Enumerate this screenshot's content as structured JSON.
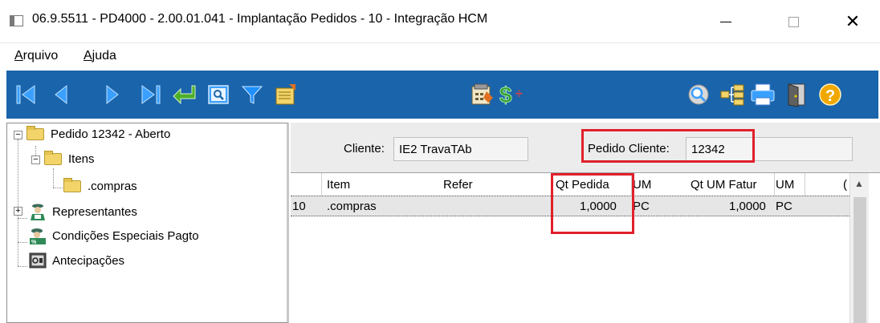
{
  "window": {
    "title": "06.9.5511 - PD4000 - 2.00.01.041 - Implantação Pedidos - 10 - Integração HCM",
    "minimize_glyph": "—",
    "close_glyph": "✕"
  },
  "menu": {
    "items": [
      {
        "label": "Arquivo",
        "mnemonic": "A",
        "rest": "rquivo"
      },
      {
        "label": "Ajuda",
        "mnemonic": "A",
        "rest": "juda"
      }
    ]
  },
  "toolbar": {
    "icons": [
      "first-record-icon",
      "previous-record-icon",
      "next-record-icon",
      "last-record-icon",
      "return-enter-icon",
      "zoom-search-icon",
      "filter-funnel-icon",
      "edit-document-icon",
      "calculator-notepad-icon",
      "money-dollar-icon",
      "query-magnifier-icon",
      "tree-structure-icon",
      "printer-icon",
      "exit-door-icon",
      "help-question-icon"
    ],
    "colors": {
      "background": "#1a64ab",
      "arrows": "#3aa0ff",
      "return": "#4caf2a",
      "filter": "#1e90ff",
      "dollar": "#2e9e2e",
      "help": "#f0a800"
    }
  },
  "tree": {
    "nodes": [
      {
        "label": "Pedido 12342 - Aberto",
        "expander": "−",
        "icon": "folder-icon"
      },
      {
        "label": "Itens",
        "expander": "−",
        "icon": "folder-icon"
      },
      {
        "label": ".compras",
        "icon": "folder-icon"
      },
      {
        "label": "Representantes",
        "expander": "+",
        "icon": "representative-icon"
      },
      {
        "label": "Condições Especiais Pagto",
        "icon": "payment-conditions-icon"
      },
      {
        "label": "Antecipações",
        "icon": "safe-box-icon"
      }
    ]
  },
  "header": {
    "cliente_label": "Cliente:",
    "cliente_value": "IE2 TravaTAb",
    "pedido_cliente_label": "Pedido Cliente:",
    "pedido_cliente_value": "12342"
  },
  "grid": {
    "columns": [
      "Item",
      "Refer",
      "Qt Pedida",
      "UM",
      "Qt UM Fatur",
      "UM",
      "("
    ],
    "rows": [
      {
        "seq": "10",
        "item": ".compras",
        "refer": "",
        "qt_pedida": "1,0000",
        "um": "PC",
        "qt_um_fatur": "1,0000",
        "um2": "PC"
      }
    ]
  },
  "highlight_color": "#e0202b"
}
